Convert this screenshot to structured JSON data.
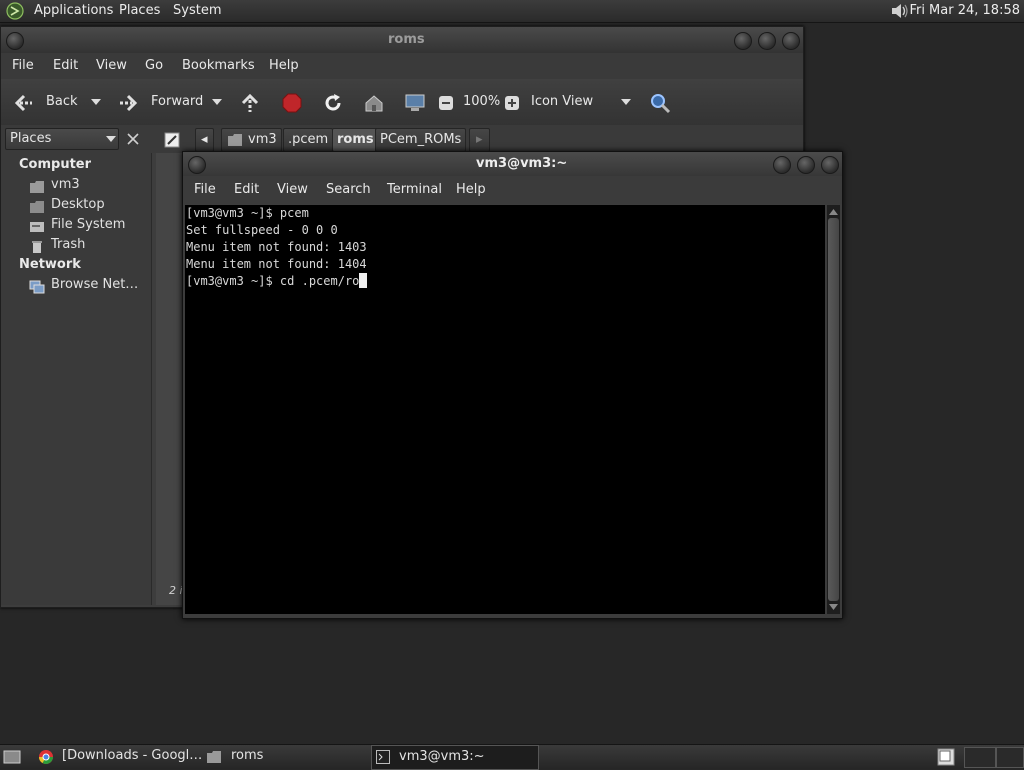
{
  "top_panel": {
    "menus": [
      "Applications",
      "Places",
      "System"
    ],
    "clock": "Fri Mar 24, 18:58"
  },
  "file_manager": {
    "title": "roms",
    "menus": [
      "File",
      "Edit",
      "View",
      "Go",
      "Bookmarks",
      "Help"
    ],
    "toolbar": {
      "back_label": "Back",
      "forward_label": "Forward",
      "zoom": "100%",
      "view_mode": "Icon View"
    },
    "places_label": "Places",
    "breadcrumbs": [
      "vm3",
      ".pcem",
      "roms",
      "PCem_ROMs"
    ],
    "sidebar": {
      "computer_heading": "Computer",
      "computer_items": [
        "vm3",
        "Desktop",
        "File System",
        "Trash"
      ],
      "network_heading": "Network",
      "network_items": [
        "Browse Net…"
      ]
    },
    "status": "2 i"
  },
  "terminal": {
    "title": "vm3@vm3:~",
    "menus": [
      "File",
      "Edit",
      "View",
      "Search",
      "Terminal",
      "Help"
    ],
    "lines": [
      "[vm3@vm3 ~]$ pcem",
      "Set fullspeed - 0 0 0",
      "Menu item not found: 1403",
      "Menu item not found: 1404",
      "[vm3@vm3 ~]$ cd .pcem/ro"
    ]
  },
  "taskbar": {
    "tasks": [
      "[Downloads - Googl…",
      "roms",
      "vm3@vm3:~"
    ]
  },
  "colors": {
    "desktop": "#272727",
    "terminal_bg": "#000000",
    "stop_icon": "#c0262a"
  }
}
